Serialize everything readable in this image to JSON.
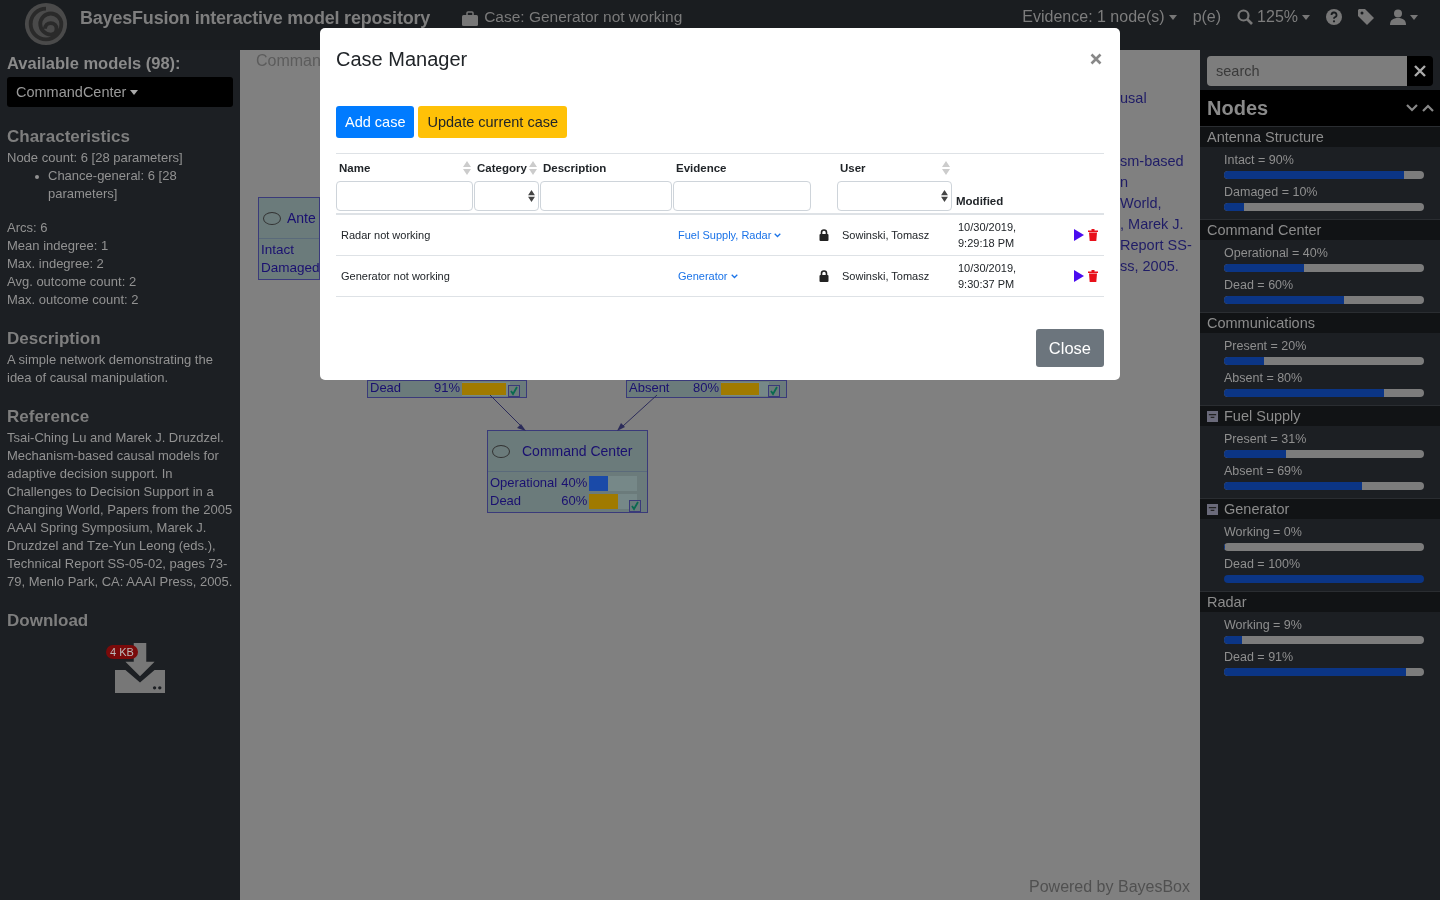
{
  "header": {
    "brand": "BayesFusion interactive model repository",
    "case": "Case: Generator not working",
    "evidence": "Evidence: 1 node(s)",
    "pe": "p(e)",
    "zoom": "125%"
  },
  "sidebar": {
    "models_label": "Available models (98):",
    "model": "CommandCenter",
    "characteristics": {
      "title": "Characteristics",
      "node_count": "Node count: 6 [28 parameters]",
      "types": [
        "Chance-general: 6 [28 parameters]"
      ],
      "stats": [
        "Arcs: 6",
        "Mean indegree: 1",
        "Max. indegree: 2",
        "Avg. outcome count: 2",
        "Max. outcome count: 2"
      ]
    },
    "description": {
      "title": "Description",
      "text": "A simple network demonstrating the idea of causal manipulation."
    },
    "reference": {
      "title": "Reference",
      "text": "Tsai-Ching Lu and Marek J. Druzdzel. Mechanism-based causal models for adaptive decision support. In Challenges to Decision Support in a Changing World, Papers from the 2005 AAAI Spring Symposium, Marek J. Druzdzel and Tze-Yun Leong (eds.), Technical Report SS-05-02, pages 73-79, Menlo Park, CA: AAAI Press, 2005."
    },
    "download": {
      "title": "Download",
      "size": "4 KB"
    }
  },
  "canvas": {
    "title": "Comman",
    "text_fragments": [
      "usal",
      "sm-based",
      "n",
      "World,",
      ", Marek J.",
      "Report SS-",
      "ss, 2005."
    ],
    "nodes": [
      {
        "kind": "cut",
        "name": "Ante",
        "states": [
          {
            "label": "Intact"
          },
          {
            "label": "Damaged"
          }
        ]
      },
      {
        "kind": "stub",
        "states": [
          {
            "label": "Dead",
            "value": "91%",
            "level": 0.91
          }
        ]
      },
      {
        "kind": "stub",
        "states": [
          {
            "label": "Absent",
            "value": "80%",
            "level": 0.8
          }
        ]
      },
      {
        "kind": "full",
        "name": "Command Center",
        "states": [
          {
            "label": "Operational",
            "value": "40%",
            "level": 0.4
          },
          {
            "label": "Dead",
            "value": "60%",
            "level": 0.6
          }
        ]
      }
    ],
    "footer": "Powered by BayesBox"
  },
  "modal": {
    "title": "Case Manager",
    "add_button": "Add case",
    "update_button": "Update current case",
    "columns": [
      {
        "label": "Name",
        "sortable": true,
        "kind": "text"
      },
      {
        "label": "Category",
        "sortable": true,
        "kind": "select"
      },
      {
        "label": "Description",
        "sortable": false,
        "kind": "text"
      },
      {
        "label": "Evidence",
        "sortable": false,
        "kind": "text"
      },
      {
        "label": "User",
        "sortable": true,
        "kind": "select"
      },
      {
        "label": "Modified",
        "sortable": false,
        "kind": "plain"
      }
    ],
    "rows": [
      {
        "name": "Radar not working",
        "evidence": "Fuel Supply, Radar",
        "locked": true,
        "user": "Sowinski, Tomasz",
        "modified_date": "10/30/2019,",
        "modified_time": "9:29:18 PM"
      },
      {
        "name": "Generator not working",
        "evidence": "Generator",
        "locked": true,
        "user": "Sowinski, Tomasz",
        "modified_date": "10/30/2019,",
        "modified_time": "9:30:37 PM"
      }
    ],
    "close_button": "Close"
  },
  "nodes_panel": {
    "search_placeholder": "search",
    "title": "Nodes",
    "nodes": [
      {
        "name": "Antenna Structure",
        "evidence": false,
        "states": [
          {
            "label": "Intact = 90%",
            "level": 0.9
          },
          {
            "label": "Damaged = 10%",
            "level": 0.1
          }
        ]
      },
      {
        "name": "Command Center",
        "evidence": false,
        "states": [
          {
            "label": "Operational = 40%",
            "level": 0.4
          },
          {
            "label": "Dead = 60%",
            "level": 0.6
          }
        ]
      },
      {
        "name": "Communications",
        "evidence": false,
        "states": [
          {
            "label": "Present = 20%",
            "level": 0.2
          },
          {
            "label": "Absent = 80%",
            "level": 0.8
          }
        ]
      },
      {
        "name": "Fuel Supply",
        "evidence": true,
        "states": [
          {
            "label": "Present = 31%",
            "level": 0.31
          },
          {
            "label": "Absent = 69%",
            "level": 0.69
          }
        ]
      },
      {
        "name": "Generator",
        "evidence": true,
        "states": [
          {
            "label": "Working = 0%",
            "level": 0
          },
          {
            "label": "Dead = 100%",
            "level": 1
          }
        ]
      },
      {
        "name": "Radar",
        "evidence": false,
        "states": [
          {
            "label": "Working = 9%",
            "level": 0.09
          },
          {
            "label": "Dead = 91%",
            "level": 0.91
          }
        ]
      }
    ]
  }
}
